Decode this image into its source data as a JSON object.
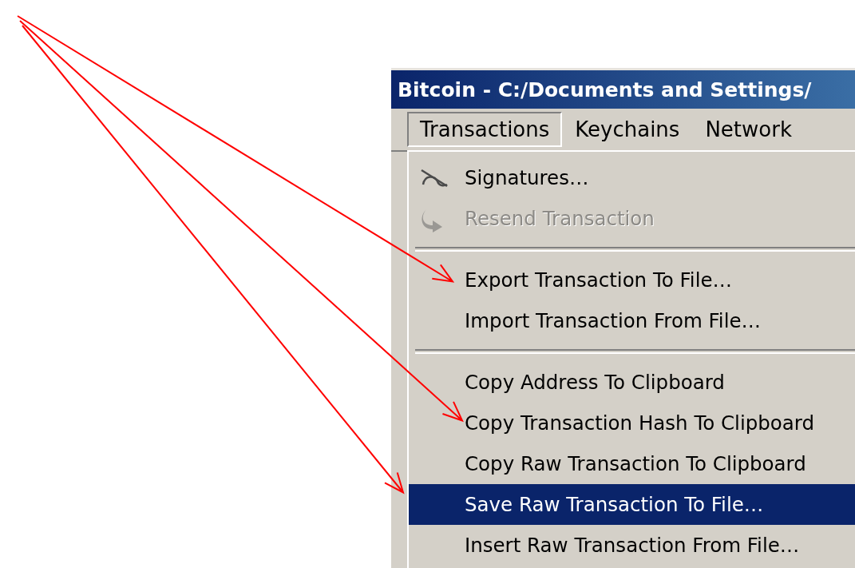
{
  "window": {
    "title": "Bitcoin - C:/Documents and Settings/"
  },
  "menu_bar": [
    {
      "label": "Transactions",
      "selected": true
    },
    {
      "label": "Keychains",
      "selected": false
    },
    {
      "label": "Network",
      "selected": false
    }
  ],
  "menu_items": [
    {
      "kind": "signature",
      "label": "Signatures…",
      "disabled": false,
      "selected": false,
      "pointed": false
    },
    {
      "kind": "resend",
      "label": "Resend Transaction",
      "disabled": true,
      "selected": false,
      "pointed": false
    },
    {
      "kind": "separator"
    },
    {
      "kind": "item",
      "label": "Export Transaction To File…",
      "disabled": false,
      "selected": false,
      "pointed": true
    },
    {
      "kind": "item",
      "label": "Import Transaction From File…",
      "disabled": false,
      "selected": false,
      "pointed": false
    },
    {
      "kind": "separator"
    },
    {
      "kind": "item",
      "label": "Copy Address To Clipboard",
      "disabled": false,
      "selected": false,
      "pointed": false
    },
    {
      "kind": "item",
      "label": "Copy Transaction Hash To Clipboard",
      "disabled": false,
      "selected": false,
      "pointed": true
    },
    {
      "kind": "item",
      "label": "Copy Raw Transaction To Clipboard",
      "disabled": false,
      "selected": false,
      "pointed": false
    },
    {
      "kind": "item",
      "label": "Save Raw Transaction To File…",
      "disabled": false,
      "selected": true,
      "pointed": true
    },
    {
      "kind": "item",
      "label": "Insert Raw Transaction From File…",
      "disabled": false,
      "selected": false,
      "pointed": false
    }
  ]
}
